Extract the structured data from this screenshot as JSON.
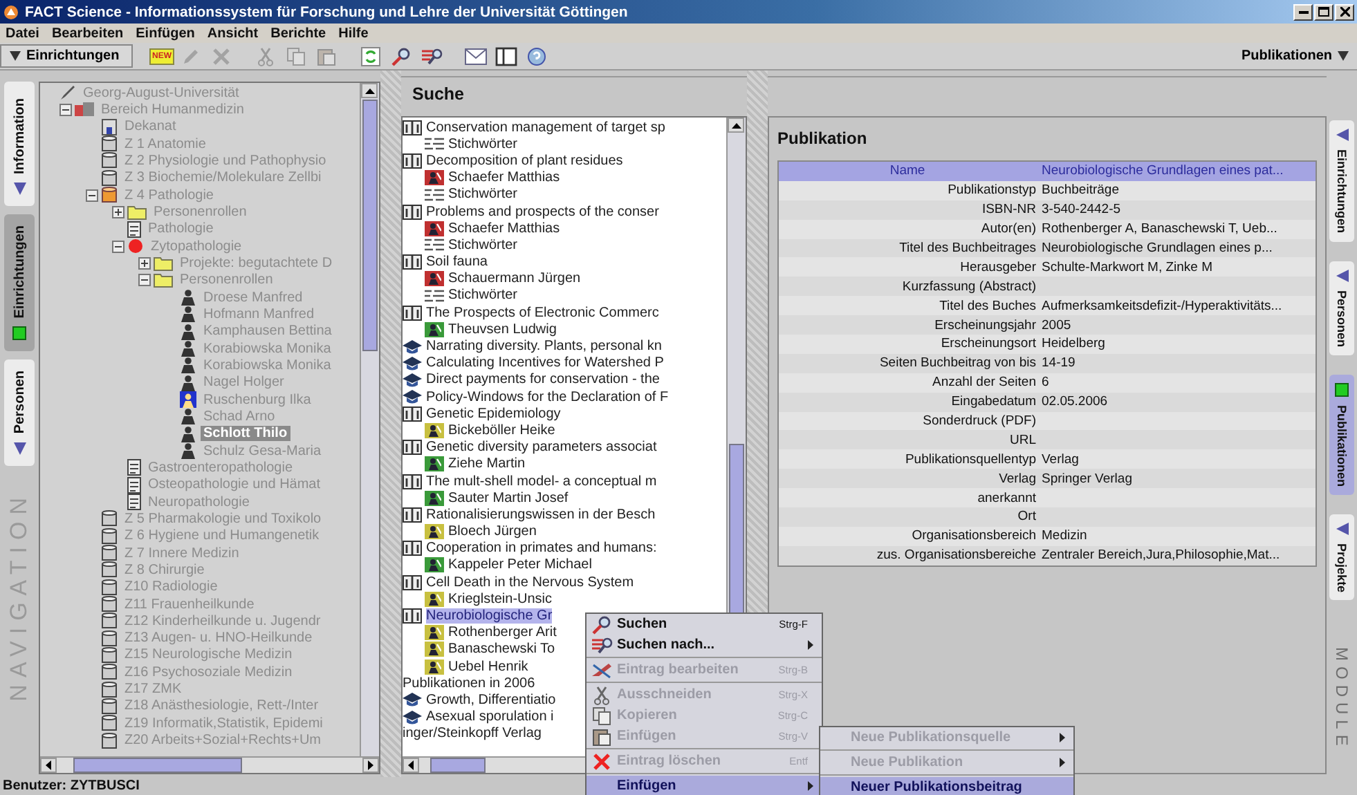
{
  "window": {
    "title": "FACT Science - Informationssystem für Forschung und Lehre der Universität Göttingen"
  },
  "menu": [
    "Datei",
    "Bearbeiten",
    "Einfügen",
    "Ansicht",
    "Berichte",
    "Hilfe"
  ],
  "toolbar": {
    "module_button": "Einrichtungen",
    "right_button": "Publikationen",
    "tools": [
      {
        "kind": "new",
        "label": "NEW",
        "disabled": false
      },
      {
        "kind": "edit",
        "disabled": true
      },
      {
        "kind": "delete",
        "disabled": true
      },
      {
        "kind": "cut",
        "disabled": true
      },
      {
        "kind": "copy",
        "disabled": true
      },
      {
        "kind": "paste",
        "disabled": true
      },
      {
        "kind": "refresh",
        "disabled": false
      },
      {
        "kind": "search",
        "disabled": false
      },
      {
        "kind": "search_by",
        "disabled": false
      },
      {
        "kind": "mail",
        "disabled": false
      },
      {
        "kind": "frame",
        "disabled": false
      },
      {
        "kind": "help",
        "disabled": false
      }
    ]
  },
  "navigation": {
    "label": "NAVIGATION",
    "tabs": [
      {
        "label": "Information",
        "selected": false
      },
      {
        "label": "Einrichtungen",
        "selected": true
      },
      {
        "label": "Personen",
        "selected": false
      }
    ]
  },
  "tree": {
    "kind": "root",
    "label": "Georg-August-Universität",
    "selected": false,
    "children": [
      {
        "kind": "faculty",
        "label": "Bereich Humanmedizin",
        "expanded": true,
        "selected": false,
        "children": [
          {
            "kind": "office",
            "label": "Dekanat",
            "selected": false
          },
          {
            "kind": "institute",
            "label": "Z 1 Anatomie",
            "selected": false
          },
          {
            "kind": "institute",
            "label": "Z 2 Physiologie und Pathophysio",
            "selected": false
          },
          {
            "kind": "institute",
            "label": "Z 3 Biochemie/Molekulare Zellbi",
            "selected": false
          },
          {
            "kind": "clinic",
            "label": "Z 4 Pathologie",
            "expanded": true,
            "selected": false,
            "children": [
              {
                "kind": "folder",
                "label": "Personenrollen",
                "expanded": false,
                "selected": false
              },
              {
                "kind": "unit",
                "label": "Pathologie",
                "selected": false
              },
              {
                "kind": "lab",
                "label": "Zytopathologie",
                "expanded": true,
                "selected": false,
                "children": [
                  {
                    "kind": "folder",
                    "label": "Projekte: begutachtete D",
                    "expanded": false,
                    "selected": false
                  },
                  {
                    "kind": "folder",
                    "label": "Personenrollen",
                    "expanded": true,
                    "selected": false,
                    "children": [
                      {
                        "kind": "person",
                        "label": "Droese Manfred",
                        "selected": false
                      },
                      {
                        "kind": "person",
                        "label": "Hofmann Manfred",
                        "selected": false
                      },
                      {
                        "kind": "person",
                        "label": "Kamphausen Bettina",
                        "selected": false
                      },
                      {
                        "kind": "person",
                        "label": "Korabiowska Monika",
                        "selected": false
                      },
                      {
                        "kind": "person",
                        "label": "Korabiowska Monika",
                        "selected": false
                      },
                      {
                        "kind": "person",
                        "label": "Nagel Holger",
                        "selected": false
                      },
                      {
                        "kind": "contact",
                        "label": "Ruschenburg Ilka",
                        "selected": false
                      },
                      {
                        "kind": "person",
                        "label": "Schad Arno",
                        "selected": false
                      },
                      {
                        "kind": "person",
                        "label": "Schlott Thilo",
                        "selected": true
                      },
                      {
                        "kind": "person",
                        "label": "Schulz Gesa-Maria",
                        "selected": false
                      }
                    ]
                  }
                ]
              },
              {
                "kind": "unit",
                "label": "Gastroenteropathologie",
                "selected": false
              },
              {
                "kind": "unit",
                "label": "Osteopathologie und Hämat",
                "selected": false
              },
              {
                "kind": "unit",
                "label": "Neuropathologie",
                "selected": false
              }
            ]
          },
          {
            "kind": "institute",
            "label": "Z 5 Pharmakologie und Toxikolo",
            "selected": false
          },
          {
            "kind": "institute",
            "label": "Z 6 Hygiene und Humangenetik",
            "selected": false
          },
          {
            "kind": "institute",
            "label": "Z 7 Innere Medizin",
            "selected": false
          },
          {
            "kind": "institute",
            "label": "Z 8 Chirurgie",
            "selected": false
          },
          {
            "kind": "institute",
            "label": "Z10 Radiologie",
            "selected": false
          },
          {
            "kind": "institute",
            "label": "Z11 Frauenheilkunde",
            "selected": false
          },
          {
            "kind": "institute",
            "label": "Z12 Kinderheilkunde u. Jugendr",
            "selected": false
          },
          {
            "kind": "institute",
            "label": "Z13 Augen- u. HNO-Heilkunde",
            "selected": false
          },
          {
            "kind": "institute",
            "label": "Z15 Neurologische Medizin",
            "selected": false
          },
          {
            "kind": "institute",
            "label": "Z16 Psychosoziale Medizin",
            "selected": false
          },
          {
            "kind": "institute",
            "label": "Z17 ZMK",
            "selected": false
          },
          {
            "kind": "institute",
            "label": "Z18 Anästhesiologie, Rett-/Inter",
            "selected": false
          },
          {
            "kind": "institute",
            "label": "Z19 Informatik,Statistik, Epidemi",
            "selected": false
          },
          {
            "kind": "institute",
            "label": "Z20 Arbeits+Sozial+Rechts+Um",
            "selected": false
          }
        ]
      }
    ]
  },
  "search": {
    "title": "Suche",
    "items": [
      {
        "kind": "book",
        "label": "Conservation management of target sp",
        "selected": false,
        "children": [
          {
            "kind": "keywords",
            "label": "Stichwörter",
            "selected": false
          }
        ]
      },
      {
        "kind": "book",
        "label": "Decomposition of plant residues",
        "selected": false,
        "children": [
          {
            "kind": "person",
            "label": "Schaefer Matthias",
            "color": "#c03030",
            "selected": false
          },
          {
            "kind": "keywords",
            "label": "Stichwörter",
            "selected": false
          }
        ]
      },
      {
        "kind": "book",
        "label": "Problems and prospects of the conser",
        "selected": false,
        "children": [
          {
            "kind": "person",
            "label": "Schaefer Matthias",
            "color": "#c03030",
            "selected": false
          },
          {
            "kind": "keywords",
            "label": "Stichwörter",
            "selected": false
          }
        ]
      },
      {
        "kind": "book",
        "label": "Soil fauna",
        "selected": false,
        "children": [
          {
            "kind": "person",
            "label": "Schauermann Jürgen",
            "color": "#c03030",
            "selected": false
          },
          {
            "kind": "keywords",
            "label": "Stichwörter",
            "selected": false
          }
        ]
      },
      {
        "kind": "book",
        "label": "The Prospects of Electronic Commerc",
        "selected": false,
        "children": [
          {
            "kind": "person",
            "label": "Theuvsen Ludwig",
            "color": "#3a9a3a",
            "selected": false
          }
        ]
      },
      {
        "kind": "publication",
        "label": "Narrating diversity. Plants, personal kn",
        "selected": false
      },
      {
        "kind": "publication",
        "label": "Calculating Incentives for Watershed P",
        "selected": false
      },
      {
        "kind": "publication",
        "label": "Direct payments for conservation - the",
        "selected": false
      },
      {
        "kind": "publication",
        "label": "Policy-Windows for the Declaration of F",
        "selected": false
      },
      {
        "kind": "book",
        "label": "Genetic Epidemiology",
        "selected": false,
        "children": [
          {
            "kind": "person",
            "label": "Bickeböller Heike",
            "color": "#c8c040",
            "selected": false
          }
        ]
      },
      {
        "kind": "book",
        "label": "Genetic diversity parameters associat",
        "selected": false,
        "children": [
          {
            "kind": "person",
            "label": "Ziehe Martin",
            "color": "#3a9a3a",
            "selected": false
          }
        ]
      },
      {
        "kind": "book",
        "label": "The mult-shell model- a conceptual m",
        "selected": false,
        "children": [
          {
            "kind": "person",
            "label": "Sauter Martin Josef",
            "color": "#3a9a3a",
            "selected": false
          }
        ]
      },
      {
        "kind": "book",
        "label": "Rationalisierungswissen in der Besch",
        "selected": false,
        "children": [
          {
            "kind": "person",
            "label": "Bloech Jürgen",
            "color": "#c8c040",
            "selected": false
          }
        ]
      },
      {
        "kind": "book",
        "label": "Cooperation in primates and humans:",
        "selected": false,
        "children": [
          {
            "kind": "person",
            "label": "Kappeler Peter Michael",
            "color": "#3a9a3a",
            "selected": false
          }
        ]
      },
      {
        "kind": "book",
        "label": "Cell Death in the Nervous System",
        "selected": false,
        "children": [
          {
            "kind": "person",
            "label": "Krieglstein-Unsic",
            "color": "#c8c040",
            "selected": false
          }
        ]
      },
      {
        "kind": "book",
        "label": "Neurobiologische Gr",
        "selected": true,
        "children": [
          {
            "kind": "person",
            "label": "Rothenberger Arit",
            "color": "#c8c040",
            "selected": false
          },
          {
            "kind": "person",
            "label": "Banaschewski To",
            "color": "#c8c040",
            "selected": false
          },
          {
            "kind": "person",
            "label": "Uebel Henrik",
            "color": "#c8c040",
            "selected": false
          }
        ]
      },
      {
        "kind": "heading",
        "label": "Publikationen in 2006",
        "selected": false
      },
      {
        "kind": "publication",
        "label": "Growth, Differentiatio",
        "selected": false
      },
      {
        "kind": "publication",
        "label": "Asexual sporulation i",
        "selected": false
      },
      {
        "kind": "text",
        "label": "inger/Steinkopff Verlag",
        "selected": false
      }
    ]
  },
  "publication": {
    "title": "Publikation",
    "rows": [
      {
        "label": "Name",
        "value": "Neurobiologische Grundlagen eines pat...",
        "selected": true
      },
      {
        "label": "Publikationstyp",
        "value": "Buchbeiträge",
        "selected": false
      },
      {
        "label": "ISBN-NR",
        "value": "3-540-2442-5",
        "selected": false
      },
      {
        "label": "Autor(en)",
        "value": "Rothenberger A, Banaschewski T, Ueb...",
        "selected": false
      },
      {
        "label": "Titel des Buchbeitrages",
        "value": "Neurobiologische Grundlagen eines p...",
        "selected": false
      },
      {
        "label": "Herausgeber",
        "value": "Schulte-Markwort M, Zinke M",
        "selected": false
      },
      {
        "label": "Kurzfassung (Abstract)",
        "selected": false
      },
      {
        "label": "Titel des Buches",
        "value": "Aufmerksamkeitsdefizit-/Hyperaktivitäts...",
        "selected": false
      },
      {
        "label": "Erscheinungsjahr",
        "value": "2005",
        "selected": false
      },
      {
        "label": "Erscheinungsort",
        "value": "Heidelberg",
        "selected": false
      },
      {
        "label": "Seiten Buchbeitrag von bis",
        "value": "14-19",
        "selected": false
      },
      {
        "label": "Anzahl der Seiten",
        "value": "6",
        "selected": false
      },
      {
        "label": "Eingabedatum",
        "value": "02.05.2006",
        "selected": false
      },
      {
        "label": "Sonderdruck (PDF)",
        "selected": false
      },
      {
        "label": "URL",
        "selected": false
      },
      {
        "label": "Publikationsquellentyp",
        "value": "Verlag",
        "selected": false
      },
      {
        "label": "Verlag",
        "value": "Springer Verlag",
        "selected": false
      },
      {
        "label": "anerkannt",
        "selected": false
      },
      {
        "label": "Ort",
        "selected": false
      },
      {
        "label": "Organisationsbereich",
        "value": "Medizin",
        "selected": false
      },
      {
        "label": "zus. Organisationsbereiche",
        "value": "Zentraler Bereich,Jura,Philosophie,Mat...",
        "selected": false
      }
    ]
  },
  "modules": {
    "label": "MODULE",
    "tabs": [
      {
        "label": "Einrichtungen",
        "selected": false
      },
      {
        "label": "Personen",
        "selected": false
      },
      {
        "label": "Publikationen",
        "selected": true
      },
      {
        "label": "Projekte",
        "selected": false
      }
    ]
  },
  "context_menu": {
    "items": [
      {
        "kind": "search",
        "label": "Suchen",
        "shortcut": "Strg-F",
        "disabled": false,
        "selected": false
      },
      {
        "kind": "search_by",
        "label": "Suchen nach...",
        "submenu": true,
        "disabled": false,
        "selected": false
      },
      {
        "kind": "separator"
      },
      {
        "kind": "edit",
        "label": "Eintrag bearbeiten",
        "shortcut": "Strg-B",
        "disabled": true,
        "selected": false
      },
      {
        "kind": "separator"
      },
      {
        "kind": "cut",
        "label": "Ausschneiden",
        "shortcut": "Strg-X",
        "disabled": true,
        "selected": false
      },
      {
        "kind": "copy",
        "label": "Kopieren",
        "shortcut": "Strg-C",
        "disabled": true,
        "selected": false
      },
      {
        "kind": "paste",
        "label": "Einfügen",
        "shortcut": "Strg-V",
        "disabled": true,
        "selected": false
      },
      {
        "kind": "separator"
      },
      {
        "kind": "delete",
        "label": "Eintrag löschen",
        "shortcut": "Entf",
        "disabled": true,
        "selected": false
      },
      {
        "kind": "separator"
      },
      {
        "kind": "insert",
        "label": "Einfügen",
        "submenu": true,
        "disabled": false,
        "selected": true
      }
    ]
  },
  "submenu": {
    "items": [
      {
        "label": "Neue Publikationsquelle",
        "submenu": true,
        "disabled": true,
        "selected": false
      },
      {
        "label": "Neue Publikation",
        "submenu": true,
        "disabled": true,
        "selected": false
      },
      {
        "label": "Neuer Publikationsbeitrag",
        "disabled": false,
        "selected": true
      }
    ]
  },
  "status_bar": {
    "user": "Benutzer: ZYTBUSCI"
  }
}
